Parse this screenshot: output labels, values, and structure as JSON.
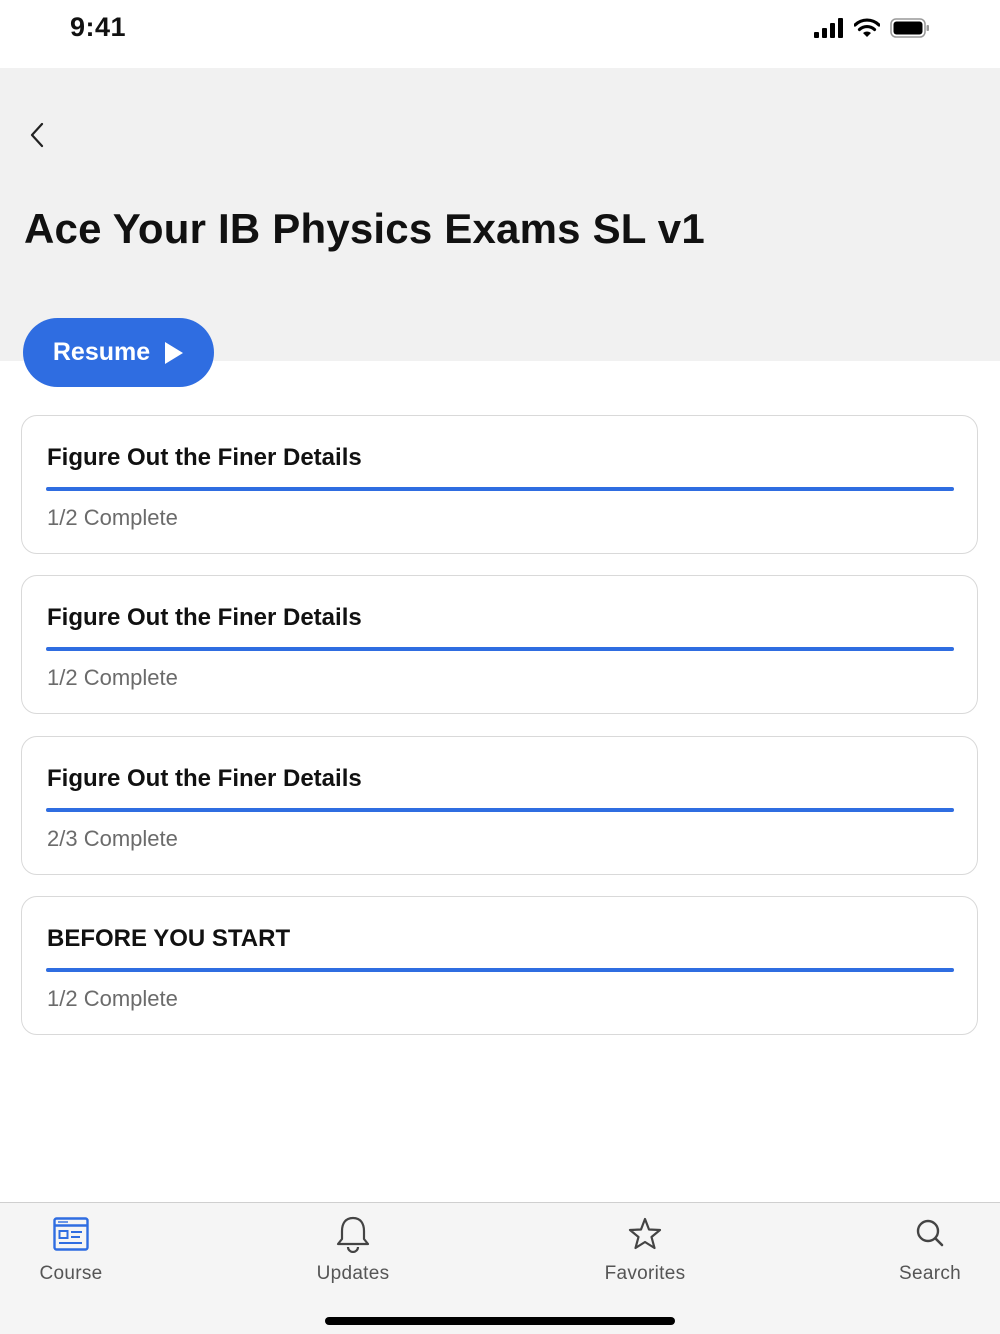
{
  "status_bar": {
    "time": "9:41",
    "icons": [
      "signal-icon",
      "wifi-icon",
      "battery-icon"
    ]
  },
  "header": {
    "back_icon": "chevron-left-icon",
    "title": "Ace Your IB Physics Exams SL v1"
  },
  "resume": {
    "label": "Resume",
    "icon": "play-icon"
  },
  "colors": {
    "accent": "#2f6de1",
    "header_bg": "#f1f1f1",
    "tab_bar_bg": "#f5f5f5"
  },
  "sections": [
    {
      "title": "Figure Out the Finer Details",
      "status": "1/2 Complete",
      "progress": 1.0
    },
    {
      "title": "Figure Out the Finer Details",
      "status": "1/2 Complete",
      "progress": 1.0
    },
    {
      "title": "Figure Out the Finer Details",
      "status": "2/3 Complete",
      "progress": 1.0
    },
    {
      "title": "BEFORE YOU START",
      "status": "1/2 Complete",
      "progress": 1.0
    }
  ],
  "tabs": [
    {
      "label": "Course",
      "icon": "course-icon",
      "active": true
    },
    {
      "label": "Updates",
      "icon": "bell-icon",
      "active": false
    },
    {
      "label": "Favorites",
      "icon": "star-icon",
      "active": false
    },
    {
      "label": "Search",
      "icon": "search-icon",
      "active": false
    }
  ]
}
